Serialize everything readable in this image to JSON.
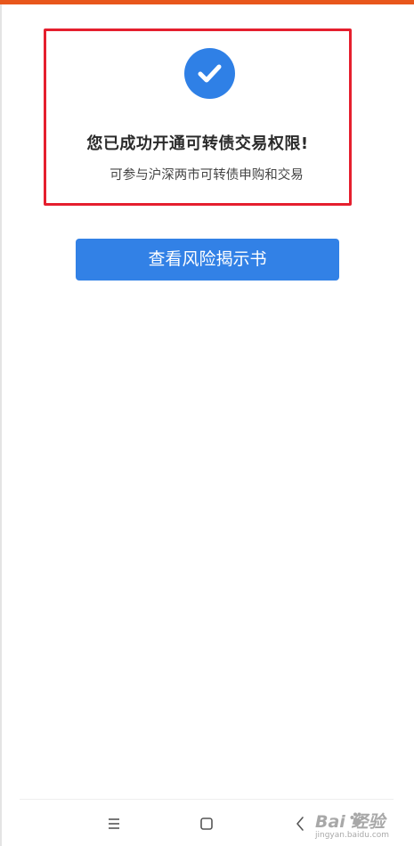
{
  "header": {
    "accent_color": "#e8571c"
  },
  "result": {
    "status_icon": "check-circle-icon",
    "title": "您已成功开通可转债交易权限!",
    "subtitle": "可参与沪深两市可转债申购和交易",
    "highlight_color": "#e51f2e",
    "icon_color": "#2f80e6"
  },
  "actions": {
    "risk_disclosure_label": "查看风险揭示书",
    "button_color": "#3281e6"
  },
  "navigation": {
    "menu_icon": "menu-icon",
    "home_icon": "home-icon",
    "back_icon": "back-icon"
  },
  "watermark": {
    "brand": "Bai  经验",
    "url": "jingyan.baidu.com"
  }
}
